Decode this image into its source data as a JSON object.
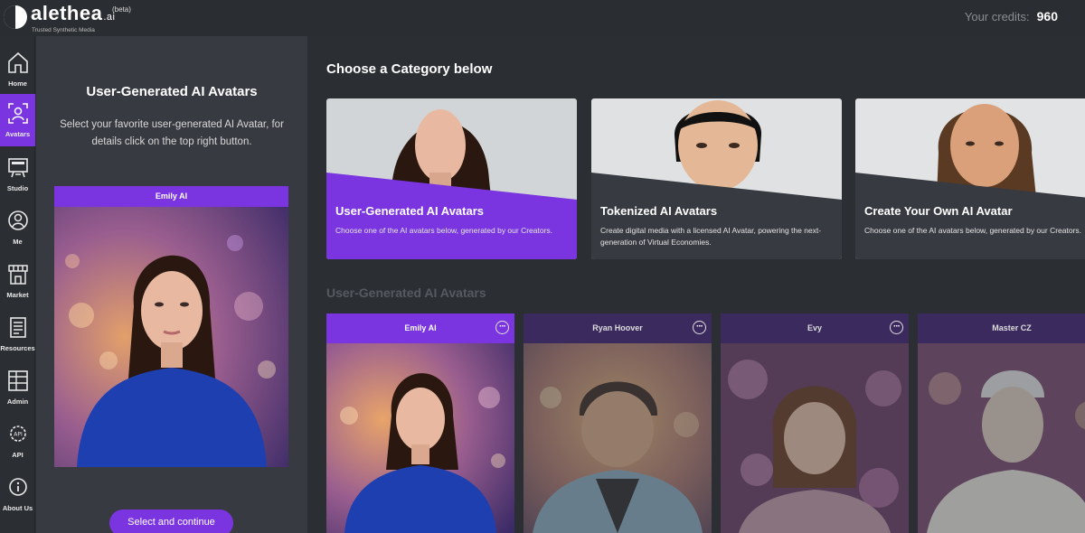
{
  "app": {
    "logo_word": "alethea",
    "logo_suffix": ".ai",
    "beta": "(beta)",
    "tagline": "Trusted Synthetic Media"
  },
  "credits": {
    "label": "Your credits:",
    "value": "960"
  },
  "nav": [
    {
      "label": "Home",
      "icon": "home-icon"
    },
    {
      "label": "Avatars",
      "icon": "avatar-scan-icon",
      "active": true
    },
    {
      "label": "Studio",
      "icon": "studio-icon"
    },
    {
      "label": "Me",
      "icon": "user-icon"
    },
    {
      "label": "Market",
      "icon": "market-icon"
    },
    {
      "label": "Resources",
      "icon": "document-icon"
    },
    {
      "label": "Admin",
      "icon": "admin-icon"
    },
    {
      "label": "API",
      "icon": "api-icon"
    },
    {
      "label": "About Us",
      "icon": "info-icon"
    }
  ],
  "left_panel": {
    "title": "User-Generated AI Avatars",
    "description": "Select your favorite user-generated AI Avatar, for details click on the top right button.",
    "preview_name": "Emily AI",
    "button": "Select and continue"
  },
  "main": {
    "title": "Choose a Category below",
    "categories": [
      {
        "title": "User-Generated AI Avatars",
        "description": "Choose one of the AI avatars below, generated by our Creators."
      },
      {
        "title": "Tokenized AI Avatars",
        "description": "Create digital media with a licensed AI Avatar, powering the next-generation of Virtual Economies."
      },
      {
        "title": "Create Your Own AI Avatar",
        "description": "Choose one of the AI avatars below, generated by our Creators."
      }
    ],
    "section_title": "User-Generated AI Avatars",
    "avatars": [
      {
        "name": "Emily AI",
        "selected": true
      },
      {
        "name": "Ryan Hoover"
      },
      {
        "name": "Evy"
      },
      {
        "name": "Master CZ"
      }
    ]
  },
  "colors": {
    "accent": "#7a35e0",
    "background": "#2b2e33",
    "panel": "#373a40"
  }
}
